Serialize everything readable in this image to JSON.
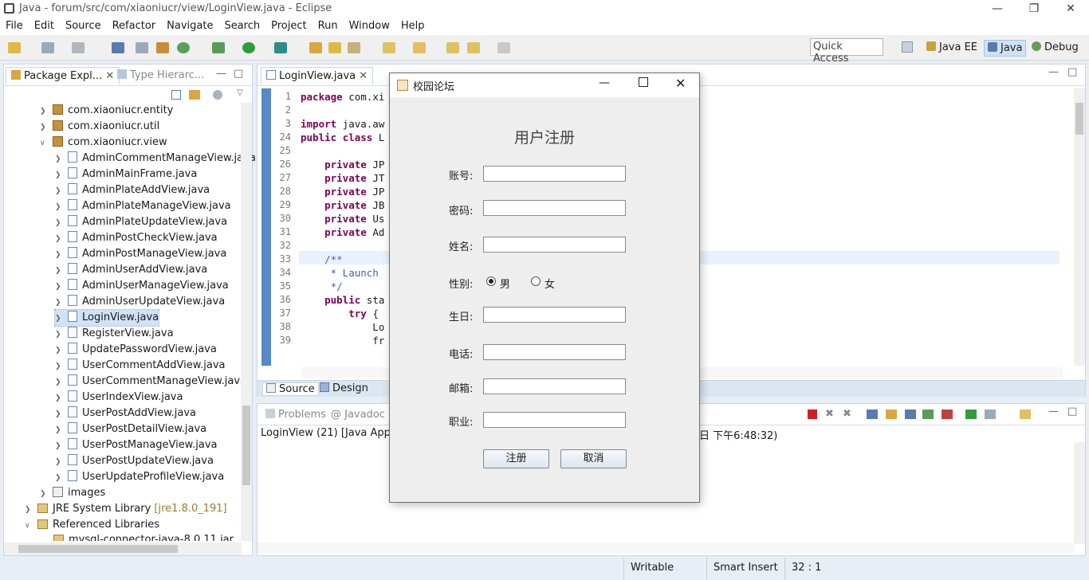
{
  "window": {
    "title": "Java - forum/src/com/xiaoniucr/view/LoginView.java - Eclipse"
  },
  "menu": [
    "File",
    "Edit",
    "Source",
    "Refactor",
    "Navigate",
    "Search",
    "Project",
    "Run",
    "Window",
    "Help"
  ],
  "toolbar": {
    "quick_access": "Quick Access",
    "perspectives": [
      "Java EE",
      "Java",
      "Debug"
    ]
  },
  "package_explorer": {
    "tabs": [
      "Package Expl...",
      "Type Hierarc..."
    ],
    "packages": [
      "com.xiaoniucr.entity",
      "com.xiaoniucr.util",
      "com.xiaoniucr.view"
    ],
    "files": [
      "AdminCommentManageView.java",
      "AdminMainFrame.java",
      "AdminPlateAddView.java",
      "AdminPlateManageView.java",
      "AdminPlateUpdateView.java",
      "AdminPostCheckView.java",
      "AdminPostManageView.java",
      "AdminUserAddView.java",
      "AdminUserManageView.java",
      "AdminUserUpdateView.java",
      "LoginView.java",
      "RegisterView.java",
      "UpdatePasswordView.java",
      "UserCommentAddView.java",
      "UserCommentManageView.java",
      "UserIndexView.java",
      "UserPostAddView.java",
      "UserPostDetailView.java",
      "UserPostManageView.java",
      "UserPostUpdateView.java",
      "UserUpdateProfileView.java"
    ],
    "images": "images",
    "jre": "JRE System Library",
    "jre_version": "[jre1.8.0_191]",
    "ref_libs": "Referenced Libraries",
    "partial": "mysql-connector-java-8.0.11.jar"
  },
  "editor": {
    "tab": "LoginView.java",
    "lines": [
      {
        "n": "1",
        "t": "package com.xi"
      },
      {
        "n": "2",
        "t": ""
      },
      {
        "n": "3",
        "t": "import java.aw"
      },
      {
        "n": "24",
        "t": "public class L"
      },
      {
        "n": "25",
        "t": ""
      },
      {
        "n": "26",
        "t": "    private JP"
      },
      {
        "n": "27",
        "t": "    private JT"
      },
      {
        "n": "28",
        "t": "    private JP"
      },
      {
        "n": "29",
        "t": "    private JB"
      },
      {
        "n": "30",
        "t": "    private Us"
      },
      {
        "n": "31",
        "t": "    private Ad"
      },
      {
        "n": "32",
        "t": ""
      },
      {
        "n": "33",
        "t": "    /**"
      },
      {
        "n": "34",
        "t": "     * Launch"
      },
      {
        "n": "35",
        "t": "     */"
      },
      {
        "n": "36",
        "t": "    public sta"
      },
      {
        "n": "37",
        "t": "        try {"
      },
      {
        "n": "38",
        "t": "            Lo"
      },
      {
        "n": "39",
        "t": "            fr"
      }
    ],
    "bottom_tabs": [
      "Source",
      "Design"
    ]
  },
  "bottom": {
    "tabs": [
      "Problems",
      "@ Javadoc"
    ],
    "console_left": "LoginView (21) [Java Applica",
    "console_right": "日 下午6:48:32)"
  },
  "status": {
    "writable": "Writable",
    "insert": "Smart Insert",
    "position": "32 : 1"
  },
  "dialog": {
    "title": "校园论坛",
    "heading": "用户注册",
    "labels": {
      "account": "账号:",
      "password": "密码:",
      "name": "姓名:",
      "gender": "性别:",
      "birthday": "生日:",
      "phone": "电话:",
      "email": "邮箱:",
      "job": "职业:"
    },
    "gender_male": "男",
    "gender_female": "女",
    "register": "注册",
    "cancel": "取消"
  }
}
